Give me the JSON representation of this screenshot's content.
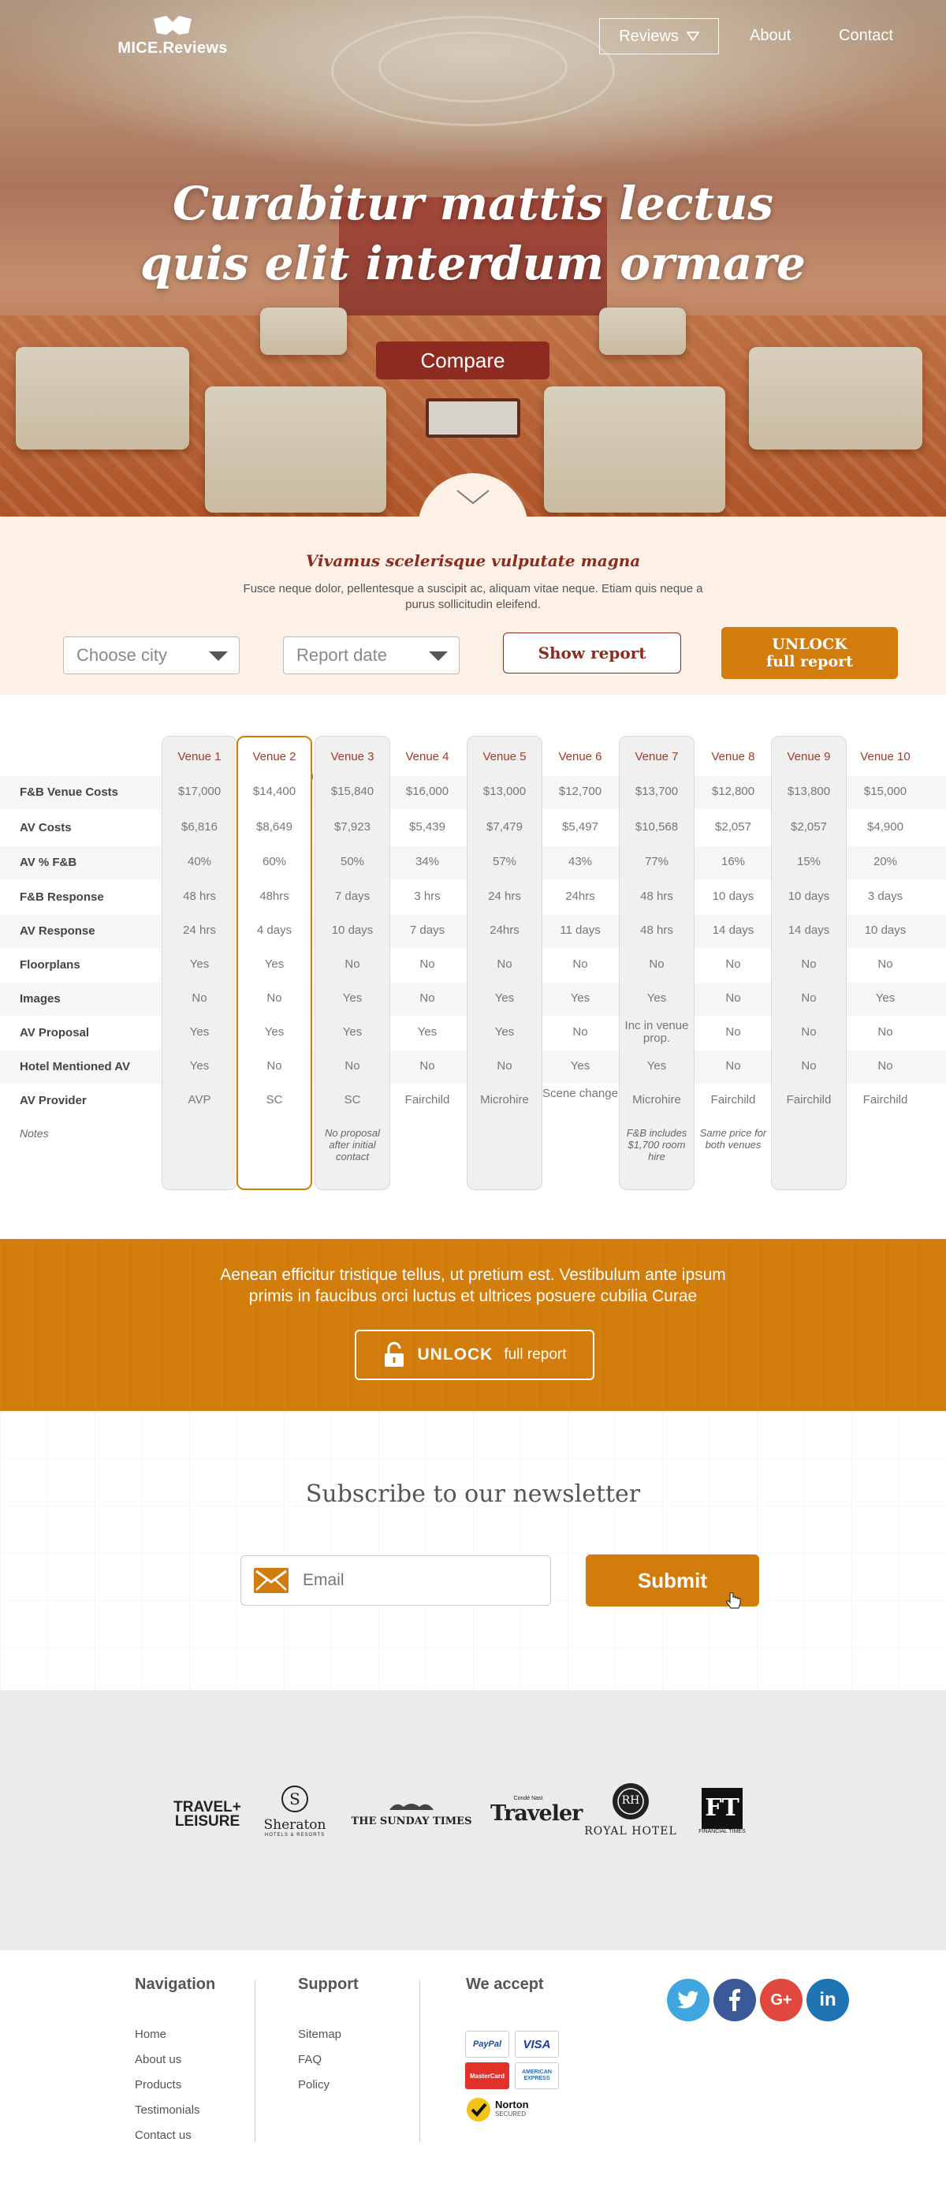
{
  "nav": {
    "logo": "MICE.Reviews",
    "reviews": "Reviews",
    "about": "About",
    "contact": "Contact"
  },
  "hero": {
    "title_line1": "Curabitur mattis lectus",
    "title_line2": "quis elit interdum ormare",
    "compare": "Compare"
  },
  "filters": {
    "heading": "Vivamus scelerisque vulputate magna",
    "description": "Fusce neque dolor, pellentesque a suscipit ac, aliquam vitae neque. Etiam quis neque a purus sollicitudin eleifend.",
    "city_placeholder": "Choose city",
    "date_placeholder": "Report date",
    "show_report": "Show report",
    "unlock_line1": "UNLOCK",
    "unlock_line2": "full report"
  },
  "table": {
    "venues": [
      "Venue 1",
      "Venue 2",
      "Venue 3",
      "Venue 4",
      "Venue 5",
      "Venue 6",
      "Venue 7",
      "Venue 8",
      "Venue 9",
      "Venue 10"
    ],
    "rows": [
      {
        "label": "F&B Venue Costs",
        "values": [
          "$17,000",
          "$14,400",
          "$15,840",
          "$16,000",
          "$13,000",
          "$12,700",
          "$13,700",
          "$12,800",
          "$13,800",
          "$15,000"
        ]
      },
      {
        "label": "AV Costs",
        "values": [
          "$6,816",
          "$8,649",
          "$7,923",
          "$5,439",
          "$7,479",
          "$5,497",
          "$10,568",
          "$2,057",
          "$2,057",
          "$4,900"
        ]
      },
      {
        "label": "AV % F&B",
        "values": [
          "40%",
          "60%",
          "50%",
          "34%",
          "57%",
          "43%",
          "77%",
          "16%",
          "15%",
          "20%"
        ]
      },
      {
        "label": "F&B Response",
        "values": [
          "48 hrs",
          "48hrs",
          "7 days",
          "3 hrs",
          "24 hrs",
          "24hrs",
          "48 hrs",
          "10 days",
          "10 days",
          "3 days"
        ]
      },
      {
        "label": "AV Response",
        "values": [
          "24 hrs",
          "4 days",
          "10 days",
          "7 days",
          "24hrs",
          "11 days",
          "48 hrs",
          "14 days",
          "14 days",
          "10 days"
        ]
      },
      {
        "label": "Floorplans",
        "values": [
          "Yes",
          "Yes",
          "No",
          "No",
          "No",
          "No",
          "No",
          "No",
          "No",
          "No"
        ]
      },
      {
        "label": "Images",
        "values": [
          "No",
          "No",
          "Yes",
          "No",
          "Yes",
          "Yes",
          "Yes",
          "No",
          "No",
          "Yes"
        ]
      },
      {
        "label": "AV Proposal",
        "values": [
          "Yes",
          "Yes",
          "Yes",
          "Yes",
          "Yes",
          "No",
          "Inc in venue prop.",
          "No",
          "No",
          "No"
        ]
      },
      {
        "label": "Hotel Mentioned AV",
        "values": [
          "Yes",
          "No",
          "No",
          "No",
          "No",
          "Yes",
          "Yes",
          "No",
          "No",
          "No"
        ]
      },
      {
        "label": "AV Provider",
        "values": [
          "AVP",
          "SC",
          "SC",
          "Fairchild",
          "Microhire",
          "Scene change",
          "Microhire",
          "Fairchild",
          "Fairchild",
          "Fairchild"
        ]
      }
    ],
    "notes_label": "Notes",
    "notes": [
      "",
      "",
      "No proposal after initial contact",
      "",
      "",
      "",
      "F&B includes $1,700 room hire",
      "Same price for both venues",
      "",
      ""
    ]
  },
  "cta": {
    "text": "Aenean efficitur tristique tellus, ut pretium est. Vestibulum ante ipsum primis in faucibus orci luctus et ultrices posuere cubilia Curae",
    "unlock": "UNLOCK",
    "full_report": "full report"
  },
  "newsletter": {
    "heading": "Subscribe to our newsletter",
    "email_placeholder": "Email",
    "submit": "Submit"
  },
  "brands": {
    "travel": "TRAVEL+ LEISURE",
    "sheraton": "Sheraton",
    "sheraton_sub": "HOTELS & RESORTS",
    "sunday_times": "THE SUNDAY TIMES",
    "traveler": "Traveler",
    "traveler_top": "Condé Nast",
    "royal": "ROYAL HOTEL",
    "royal_mark": "RH",
    "ft": "FT",
    "ft_sub": "FINANCIAL TIMES"
  },
  "footer": {
    "nav_heading": "Navigation",
    "nav_links": [
      "Home",
      "About us",
      "Products",
      "Testimonials",
      "Contact us"
    ],
    "support_heading": "Support",
    "support_links": [
      "Sitemap",
      "FAQ",
      "Policy"
    ],
    "accept_heading": "We accept",
    "payments": [
      "PayPal",
      "VISA",
      "MasterCard",
      "AMERICAN EXPRESS"
    ],
    "norton": "Norton",
    "norton_sub": "SECURED",
    "social": [
      "twitter-icon",
      "facebook-icon",
      "google-plus-icon",
      "linkedin-icon"
    ],
    "social_colors": [
      "#3fa6e0",
      "#3b5998",
      "#e0473d",
      "#1f74b3"
    ]
  }
}
